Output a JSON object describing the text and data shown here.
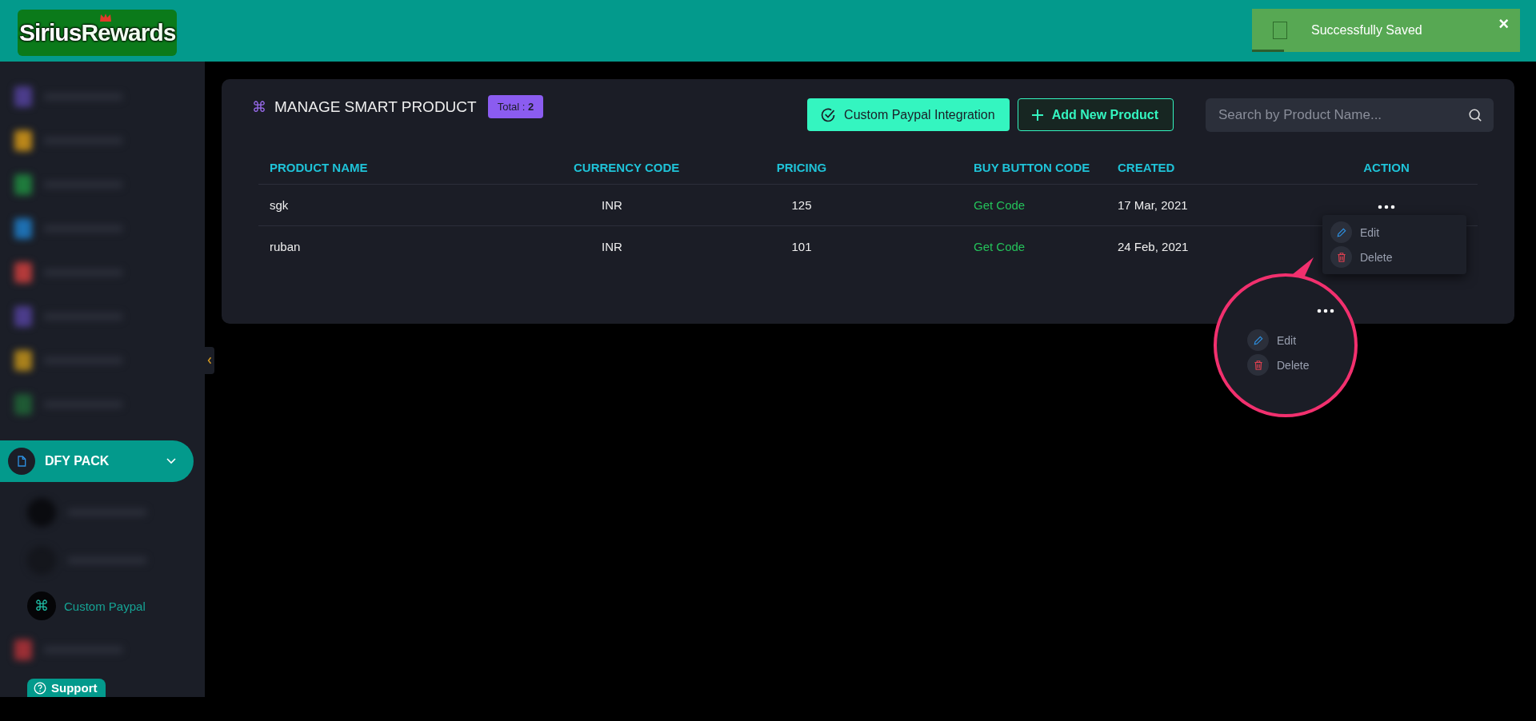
{
  "header": {
    "logo": {
      "first": "Sirius",
      "second": "Rewards"
    },
    "toast": {
      "message": "Successfully Saved",
      "close": "×",
      "level": 0.12
    }
  },
  "sidebar": {
    "items": [
      {
        "kind": "blurred",
        "color": "#4b3c8a"
      },
      {
        "kind": "blurred",
        "color": "#b9861a"
      },
      {
        "kind": "blurred",
        "color": "#1f7a3c"
      },
      {
        "kind": "blurred",
        "color": "#1e6fb0"
      },
      {
        "kind": "blurred",
        "color": "#b33a3a"
      },
      {
        "kind": "blurred",
        "color": "#4b3c8a"
      },
      {
        "kind": "blurred",
        "color": "#a8801c"
      },
      {
        "kind": "blurred",
        "color": "#1f5a34"
      },
      {
        "kind": "group",
        "label": "DFY PACK",
        "expanded": true,
        "children": [
          {
            "kind": "blurred",
            "color": "#0a0b0f"
          },
          {
            "kind": "blurred",
            "color": "#14161c"
          },
          {
            "kind": "link",
            "icon": "⌘",
            "label": "Custom Paypal",
            "selected": true
          }
        ]
      },
      {
        "kind": "blurred",
        "color": "#9a2f35"
      }
    ],
    "support": "Support"
  },
  "card": {
    "title_icon": "⌘",
    "title": "MANAGE SMART PRODUCT",
    "badge": {
      "label": "Total :",
      "value": "2"
    },
    "buttons": [
      {
        "kind": "solid",
        "label": "Custom Paypal Integration"
      },
      {
        "kind": "outline",
        "label": "Add New Product"
      }
    ],
    "search": {
      "placeholder": "Search by Product Name..."
    },
    "table": {
      "columns": [
        "PRODUCT NAME",
        "CURRENCY CODE",
        "PRICING",
        "BUY BUTTON CODE",
        "CREATED",
        "ACTION"
      ],
      "rows": [
        {
          "name": "sgk",
          "currency": "INR",
          "pricing": "125",
          "buy_code": "Get Code",
          "created": "17 Mar, 2021",
          "more_button": true
        },
        {
          "name": "ruban",
          "currency": "INR",
          "pricing": "101",
          "buy_code": "Get Code",
          "created": "24 Feb, 2021",
          "more_button": false
        }
      ]
    },
    "action_menu": {
      "open": true,
      "items": [
        {
          "kind": "edit",
          "label": "Edit"
        },
        {
          "kind": "delete",
          "label": "Delete"
        }
      ]
    }
  },
  "magnifier": {
    "items": [
      {
        "kind": "edit",
        "label": "Edit"
      },
      {
        "kind": "delete",
        "label": "Delete"
      }
    ]
  }
}
